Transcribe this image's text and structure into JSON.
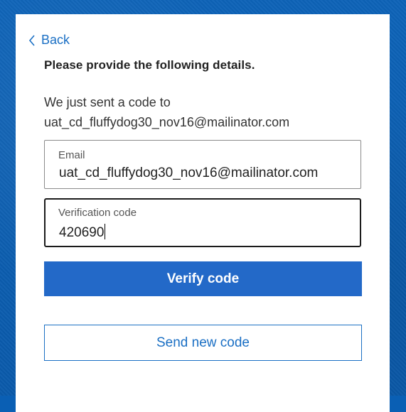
{
  "nav": {
    "back_label": "Back"
  },
  "form": {
    "heading": "Please provide the following details.",
    "info_line1": "We just sent a code to",
    "info_line2": "uat_cd_fluffydog30_nov16@mailinator.com",
    "email": {
      "label": "Email",
      "value": "uat_cd_fluffydog30_nov16@mailinator.com"
    },
    "verification_code": {
      "label": "Verification code",
      "value": "420690"
    },
    "verify_button": "Verify code",
    "send_new_button": "Send new code"
  },
  "colors": {
    "accent": "#1a6fc4",
    "primary_button": "#2369c8",
    "background": "#0a5fb4"
  },
  "icons": {
    "back": "chevron-left-icon"
  }
}
